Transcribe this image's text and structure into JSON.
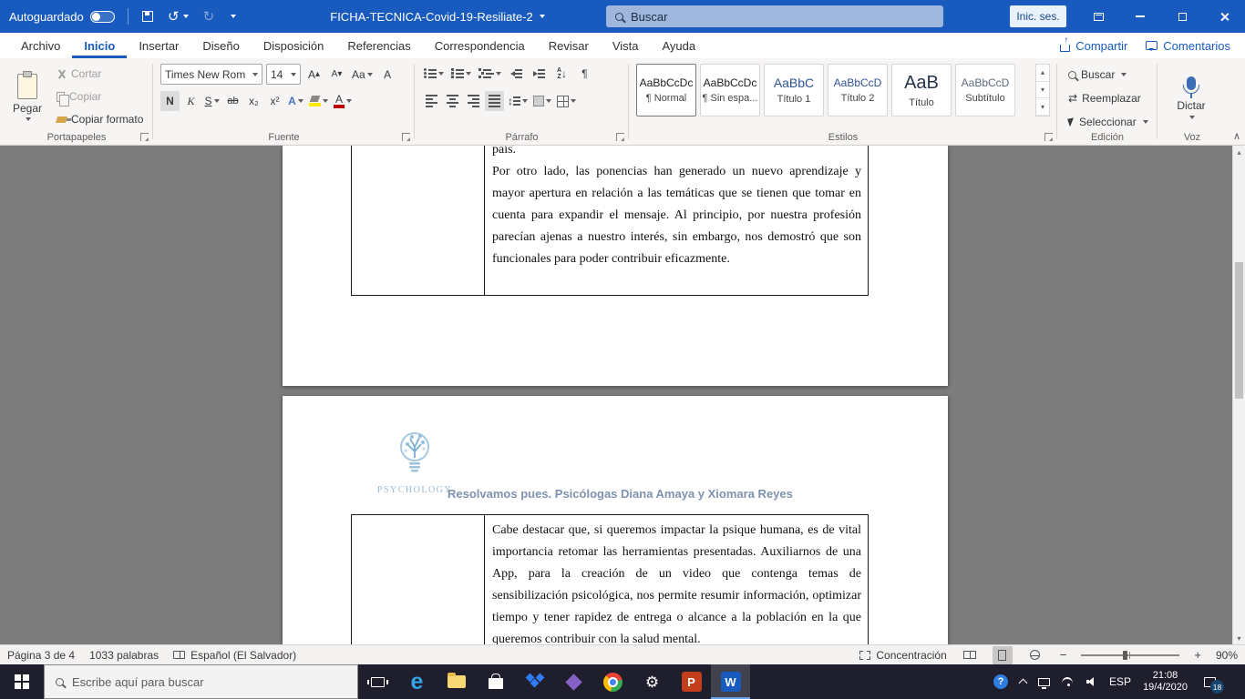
{
  "icons": {
    "undo": "↺",
    "redo": "↻",
    "up": "▴",
    "down": "▾",
    "pilcrow": "¶",
    "swap": "⇄",
    "updown": "↕",
    "down_arrow": "↓",
    "gear": "⚙",
    "collapse": "∧",
    "minus": "−",
    "plus": "+",
    "arrow_up": "↑"
  },
  "titlebar": {
    "autosave_label": "Autoguardado",
    "doc_title": "FICHA-TECNICA-Covid-19-Resiliate-2",
    "search_placeholder": "Buscar",
    "signin_label": "Inic. ses."
  },
  "menubar": {
    "tabs": [
      "Archivo",
      "Inicio",
      "Insertar",
      "Diseño",
      "Disposición",
      "Referencias",
      "Correspondencia",
      "Revisar",
      "Vista",
      "Ayuda"
    ],
    "share_label": "Compartir",
    "comments_label": "Comentarios"
  },
  "ribbon": {
    "clipboard": {
      "paste_label": "Pegar",
      "cut_label": "Cortar",
      "copy_label": "Copiar",
      "format_painter_label": "Copiar formato",
      "group_label": "Portapapeles"
    },
    "font": {
      "font_name": "Times New Rom",
      "font_size": "14",
      "grow_label": "A",
      "shrink_label": "A",
      "case_label": "Aa",
      "clear_label": "A",
      "bold_label": "N",
      "italic_label": "K",
      "underline_label": "S",
      "strike_label": "ab",
      "subscript_label": "x₂",
      "superscript_label": "x²",
      "effects_label": "A",
      "color_label": "A",
      "group_label": "Fuente"
    },
    "paragraph": {
      "sort_a": "A",
      "sort_z": "Z",
      "group_label": "Párrafo"
    },
    "styles": {
      "group_label": "Estilos",
      "items": [
        {
          "preview": "AaBbCcDc",
          "label": "¶ Normal"
        },
        {
          "preview": "AaBbCcDc",
          "label": "¶ Sin espa..."
        },
        {
          "preview": "AaBbC",
          "label": "Título 1"
        },
        {
          "preview": "AaBbCcD",
          "label": "Título 2"
        },
        {
          "preview": "AaB",
          "label": "Título"
        },
        {
          "preview": "AaBbCcD",
          "label": "Subtítulo"
        }
      ]
    },
    "editing": {
      "find_label": "Buscar",
      "replace_label": "Reemplazar",
      "select_label": "Seleccionar",
      "group_label": "Edición"
    },
    "voice": {
      "dictate_label": "Dictar",
      "group_label": "Voz"
    }
  },
  "document": {
    "page1": {
      "cut_line": "país.",
      "paragraph": "Por otro lado, las ponencias han generado un nuevo aprendizaje y mayor apertura en relación a las temáticas que se tienen que tomar en cuenta para expandir el mensaje. Al principio, por nuestra profesión parecían ajenas a nuestro interés, sin embargo, nos demostró que son funcionales para poder contribuir eficazmente."
    },
    "page2": {
      "logo_text": "PSYCHOLOGY",
      "heading": "Resolvamos pues. Psicólogas Diana Amaya y Xiomara Reyes",
      "paragraph": "Cabe destacar que, si queremos impactar la psique humana, es de vital importancia retomar las herramientas presentadas. Auxiliarnos de una App, para la creación de un video que contenga temas de sensibilización psicológica, nos permite resumir información, optimizar tiempo y tener rapidez de entrega o alcance a la población en la que queremos contribuir con la salud mental."
    }
  },
  "statusbar": {
    "page_info": "Página 3 de 4",
    "word_count": "1033 palabras",
    "language": "Español (El Salvador)",
    "focus_label": "Concentración",
    "zoom_value": "90%"
  },
  "taskbar": {
    "search_placeholder": "Escribe aquí para buscar",
    "language": "ESP",
    "time": "21:08",
    "date": "19/4/2020",
    "badge": "18",
    "help": "?",
    "apps": {
      "edge": "e",
      "powerpoint": "P",
      "word": "W"
    }
  }
}
